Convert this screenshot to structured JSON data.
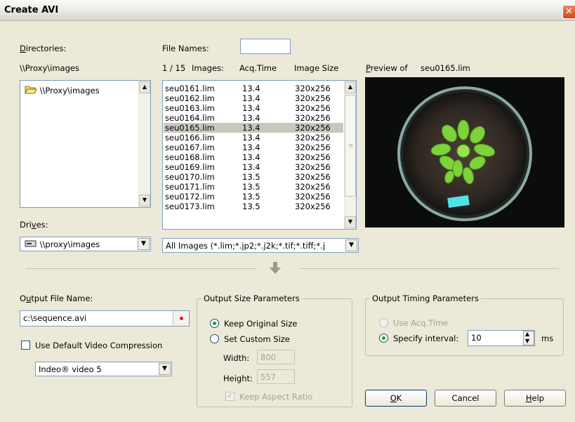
{
  "window": {
    "title": "Create AVI"
  },
  "directories": {
    "label": "Directories:",
    "path": "\\\\Proxy\\images",
    "items": [
      "\\\\Proxy\\images"
    ]
  },
  "drives": {
    "label": "Drives:",
    "selected": "\\\\proxy\\images"
  },
  "files": {
    "label": "File Names:",
    "filter_value": "",
    "count_label": "1 / 15",
    "col_images": "Images:",
    "col_acq": "Acq.Time",
    "col_size": "Image Size",
    "rows": [
      {
        "name": "seu0161.lim",
        "acq": "13.4",
        "size": "320x256"
      },
      {
        "name": "seu0162.lim",
        "acq": "13.4",
        "size": "320x256"
      },
      {
        "name": "seu0163.lim",
        "acq": "13.4",
        "size": "320x256"
      },
      {
        "name": "seu0164.lim",
        "acq": "13.4",
        "size": "320x256"
      },
      {
        "name": "seu0165.lim",
        "acq": "13.4",
        "size": "320x256"
      },
      {
        "name": "seu0166.lim",
        "acq": "13.4",
        "size": "320x256"
      },
      {
        "name": "seu0167.lim",
        "acq": "13.4",
        "size": "320x256"
      },
      {
        "name": "seu0168.lim",
        "acq": "13.4",
        "size": "320x256"
      },
      {
        "name": "seu0169.lim",
        "acq": "13.4",
        "size": "320x256"
      },
      {
        "name": "seu0170.lim",
        "acq": "13.5",
        "size": "320x256"
      },
      {
        "name": "seu0171.lim",
        "acq": "13.5",
        "size": "320x256"
      },
      {
        "name": "seu0172.lim",
        "acq": "13.5",
        "size": "320x256"
      },
      {
        "name": "seu0173.lim",
        "acq": "13.5",
        "size": "320x256"
      }
    ],
    "selected_index": 4,
    "type_filter": "All Images (*.lim;*.jp2;*.j2k;*.tif;*.tiff;*.j"
  },
  "preview": {
    "label": "Preview of",
    "file": "seu0165.lim"
  },
  "output_file": {
    "label": "Output File Name:",
    "value": "c:\\sequence.avi",
    "use_default_label": "Use Default Video Compression",
    "use_default_checked": false,
    "codec": "Indeo® video 5"
  },
  "size_params": {
    "title": "Output Size Parameters",
    "keep_original_label": "Keep Original Size",
    "set_custom_label": "Set Custom Size",
    "width_label": "Width:",
    "width_value": "800",
    "height_label": "Height:",
    "height_value": "557",
    "keep_aspect_label": "Keep Aspect Ratio",
    "selected": "keep_original"
  },
  "timing_params": {
    "title": "Output Timing Parameters",
    "use_acq_label": "Use Acq.Time",
    "specify_label": "Specify interval:",
    "interval_value": "10",
    "unit": "ms",
    "selected": "specify"
  },
  "buttons": {
    "ok": "OK",
    "cancel": "Cancel",
    "help": "Help"
  },
  "icons": [
    "folder-open-icon",
    "network-drive-icon",
    "arrow-down-icon",
    "close-icon",
    "browse-dot-icon",
    "spin-arrows-icon"
  ]
}
